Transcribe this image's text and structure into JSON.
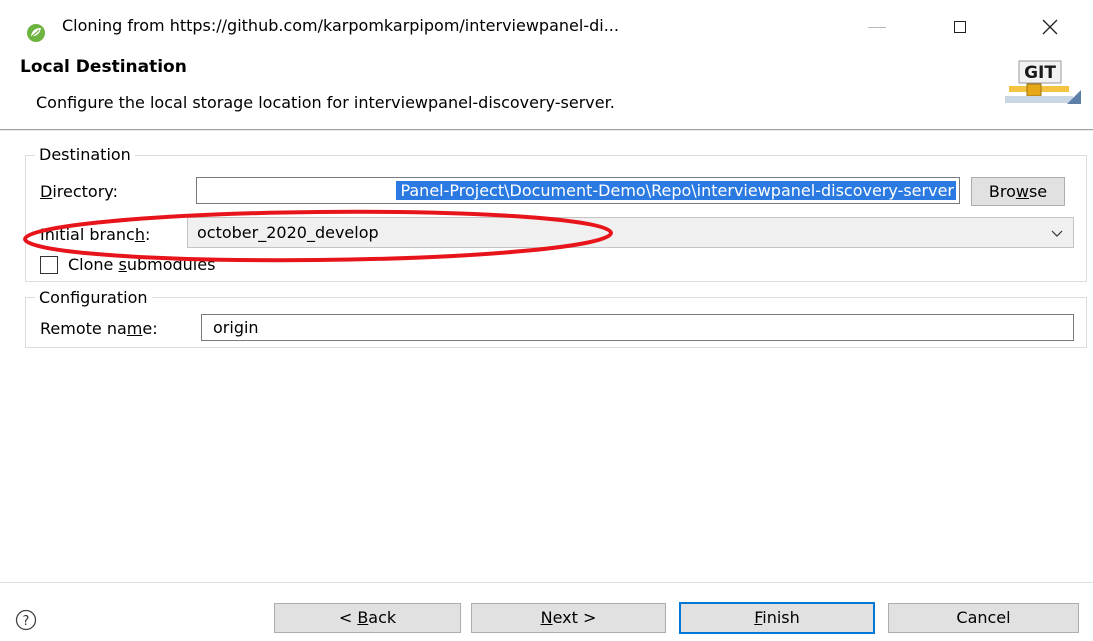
{
  "window": {
    "title": "Cloning from https://github.com/karpomkarpipom/interviewpanel-di..."
  },
  "header": {
    "title": "Local Destination",
    "description": "Configure the local storage location for interviewpanel-discovery-server.",
    "logo_text": "GIT"
  },
  "destination": {
    "group_label": "Destination",
    "directory_label_pre": "",
    "directory_label_mnemonic": "D",
    "directory_label_post": "irectory:",
    "directory_value": "Panel-Project\\Document-Demo\\Repo\\interviewpanel-discovery-server",
    "browse_pre": "Bro",
    "browse_mnemonic": "w",
    "browse_post": "se",
    "branch_label_pre": "Initial branc",
    "branch_label_mnemonic": "h",
    "branch_label_post": ":",
    "branch_value": "october_2020_develop",
    "clone_pre": "Clone ",
    "clone_mnemonic": "s",
    "clone_post": "ubmodules",
    "clone_checked": false
  },
  "configuration": {
    "group_label": "Configuration",
    "remote_label_pre": "Remote na",
    "remote_label_mnemonic": "m",
    "remote_label_post": "e:",
    "remote_value": "origin"
  },
  "footer": {
    "back_pre": "< ",
    "back_mnemonic": "B",
    "back_post": "ack",
    "next_mnemonic": "N",
    "next_post": "ext >",
    "finish_mnemonic": "F",
    "finish_post": "inish",
    "cancel_label": "Cancel"
  },
  "colors": {
    "accent": "#0078d7",
    "selection": "#2a7ae2",
    "annotation": "#e8141b",
    "button_face": "#e1e1e1"
  },
  "icons": {
    "app": "spring-leaf-icon",
    "help": "help-icon",
    "chevron": "chevron-down-icon"
  }
}
